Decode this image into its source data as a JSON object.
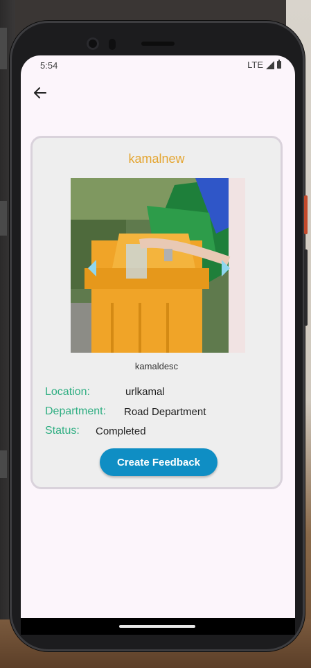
{
  "status_bar": {
    "time": "5:54",
    "network": "LTE"
  },
  "header": {
    "back_icon": "arrow-left-icon"
  },
  "card": {
    "title": "kamalnew",
    "description": "kamaldesc",
    "image_alt": "person putting a plastic bottle into an orange recycling bin",
    "details": {
      "location_label": "Location:",
      "location_value": "urlkamal",
      "department_label": "Department:",
      "department_value": "Road Department",
      "status_label": "Status:",
      "status_value": "Completed"
    },
    "action_button": "Create Feedback"
  },
  "colors": {
    "title": "#e4a530",
    "label": "#2fae82",
    "button": "#0f8ec4",
    "carousel_arrow": "#8fd6ef",
    "screen_background": "#fcf5fb",
    "card_background": "#eeeeee"
  }
}
